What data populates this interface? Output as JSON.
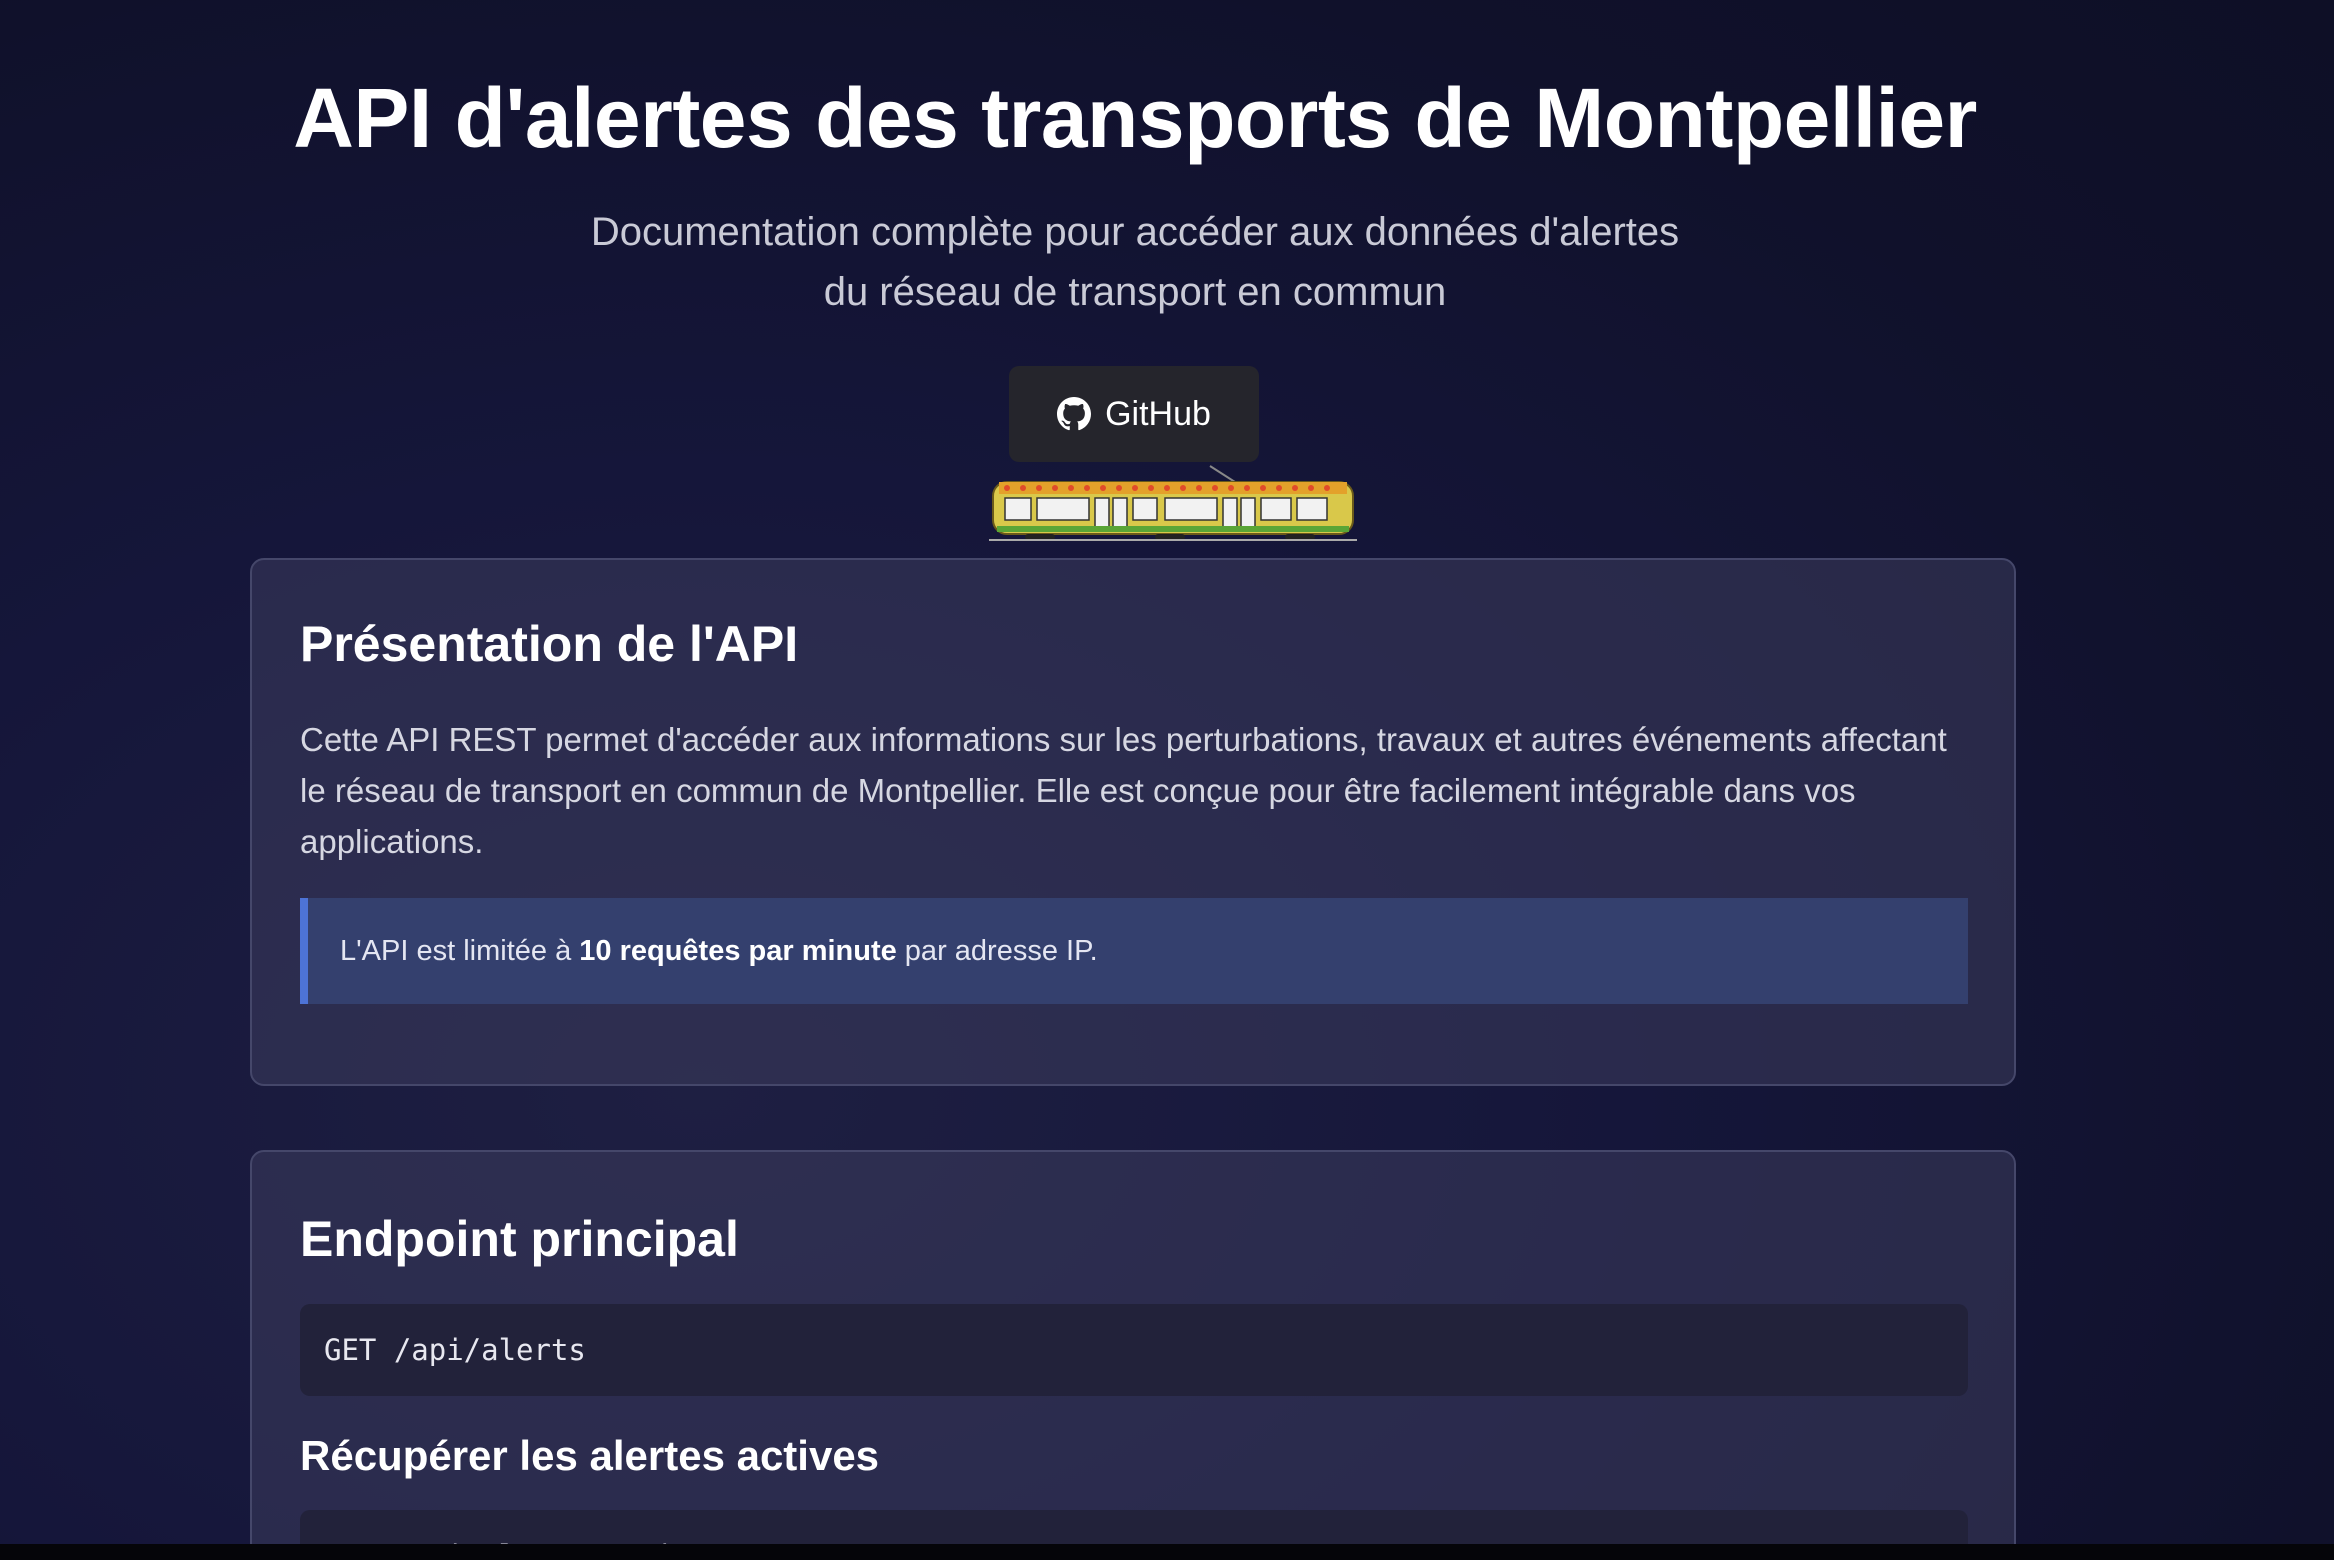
{
  "header": {
    "title": "API d'alertes des transports de Montpellier",
    "subtitle_line1": "Documentation complète pour accéder aux données d'alertes",
    "subtitle_line2": "du réseau de transport en commun",
    "github_label": "GitHub"
  },
  "icons": {
    "github": "github-icon",
    "tram": "tram-illustration"
  },
  "presentation": {
    "heading": "Présentation de l'API",
    "description": "Cette API REST permet d'accéder aux informations sur les perturbations, travaux et autres événements affectant le réseau de transport en commun de Montpellier. Elle est conçue pour être facilement intégrable dans vos applications.",
    "note_prefix": "L'API est limitée à ",
    "note_bold": "10 requêtes par minute",
    "note_suffix": " par adresse IP."
  },
  "endpoint": {
    "heading": "Endpoint principal",
    "code": "GET /api/alerts",
    "subheading": "Récupérer les alertes actives",
    "code2": "GET /api/alerts/active"
  },
  "colors": {
    "background": "#12132f",
    "card": "#2c2d4a",
    "note_bg": "#34406e",
    "note_border": "#4d73d6",
    "code_bg": "#22223a",
    "button_bg": "#25252c"
  }
}
